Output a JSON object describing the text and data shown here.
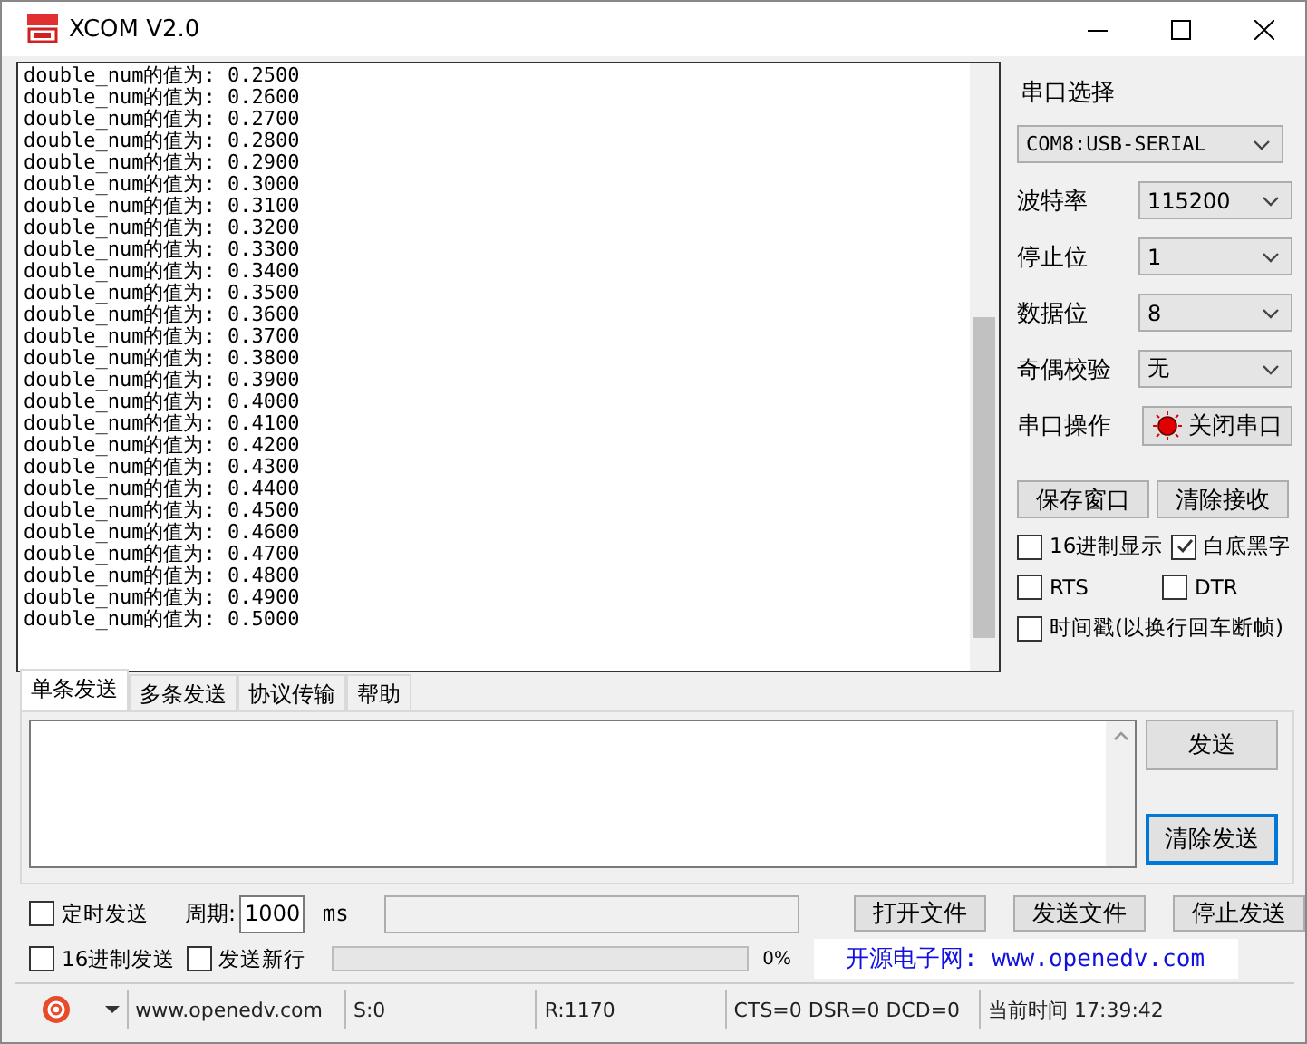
{
  "window": {
    "title": "XCOM V2.0"
  },
  "receive": {
    "lines": [
      "double_num的值为: 0.2500",
      "double_num的值为: 0.2600",
      "double_num的值为: 0.2700",
      "double_num的值为: 0.2800",
      "double_num的值为: 0.2900",
      "double_num的值为: 0.3000",
      "double_num的值为: 0.3100",
      "double_num的值为: 0.3200",
      "double_num的值为: 0.3300",
      "double_num的值为: 0.3400",
      "double_num的值为: 0.3500",
      "double_num的值为: 0.3600",
      "double_num的值为: 0.3700",
      "double_num的值为: 0.3800",
      "double_num的值为: 0.3900",
      "double_num的值为: 0.4000",
      "double_num的值为: 0.4100",
      "double_num的值为: 0.4200",
      "double_num的值为: 0.4300",
      "double_num的值为: 0.4400",
      "double_num的值为: 0.4500",
      "double_num的值为: 0.4600",
      "double_num的值为: 0.4700",
      "double_num的值为: 0.4800",
      "double_num的值为: 0.4900",
      "double_num的值为: 0.5000"
    ]
  },
  "serial": {
    "port_label": "串口选择",
    "port": "COM8:USB-SERIAL",
    "fields": [
      {
        "label": "波特率",
        "value": "115200"
      },
      {
        "label": "停止位",
        "value": "1"
      },
      {
        "label": "数据位",
        "value": "8"
      },
      {
        "label": "奇偶校验",
        "value": "无"
      }
    ],
    "operation_label": "串口操作",
    "port_button": {
      "label": "关闭串口",
      "on": true
    }
  },
  "receive_buttons": [
    "保存窗口",
    "清除接收"
  ],
  "options": [
    {
      "label": "16进制显示",
      "checked": false
    },
    {
      "label": "白底黑字",
      "checked": true
    },
    {
      "label": "RTS",
      "checked": false
    },
    {
      "label": "DTR",
      "checked": false
    },
    {
      "label": "时间戳(以换行回车断帧)",
      "checked": false
    }
  ],
  "tabs": [
    {
      "label": "单条发送",
      "selected": true
    },
    {
      "label": "多条发送",
      "selected": false
    },
    {
      "label": "协议传输",
      "selected": false
    },
    {
      "label": "帮助",
      "selected": false
    }
  ],
  "send": {
    "send_button": "发送",
    "clear_button": "清除发送"
  },
  "timer": {
    "label": "定时发送",
    "checked": false
  },
  "period_label": "周期:",
  "period": "1000",
  "unit": "ms",
  "file_buttons": [
    "打开文件",
    "发送文件",
    "停止发送"
  ],
  "send_options": [
    {
      "label": "16进制发送",
      "checked": false
    },
    {
      "label": "发送新行",
      "checked": false
    }
  ],
  "progress": {
    "level": 0,
    "reading": "0%"
  },
  "banner": "开源电子网: www.openedv.com",
  "status_bar": {
    "site": "www.openedv.com",
    "sent": "S:0",
    "received": "R:1170",
    "signals": "CTS=0 DSR=0 DCD=0",
    "time": "当前时间 17:39:42"
  }
}
